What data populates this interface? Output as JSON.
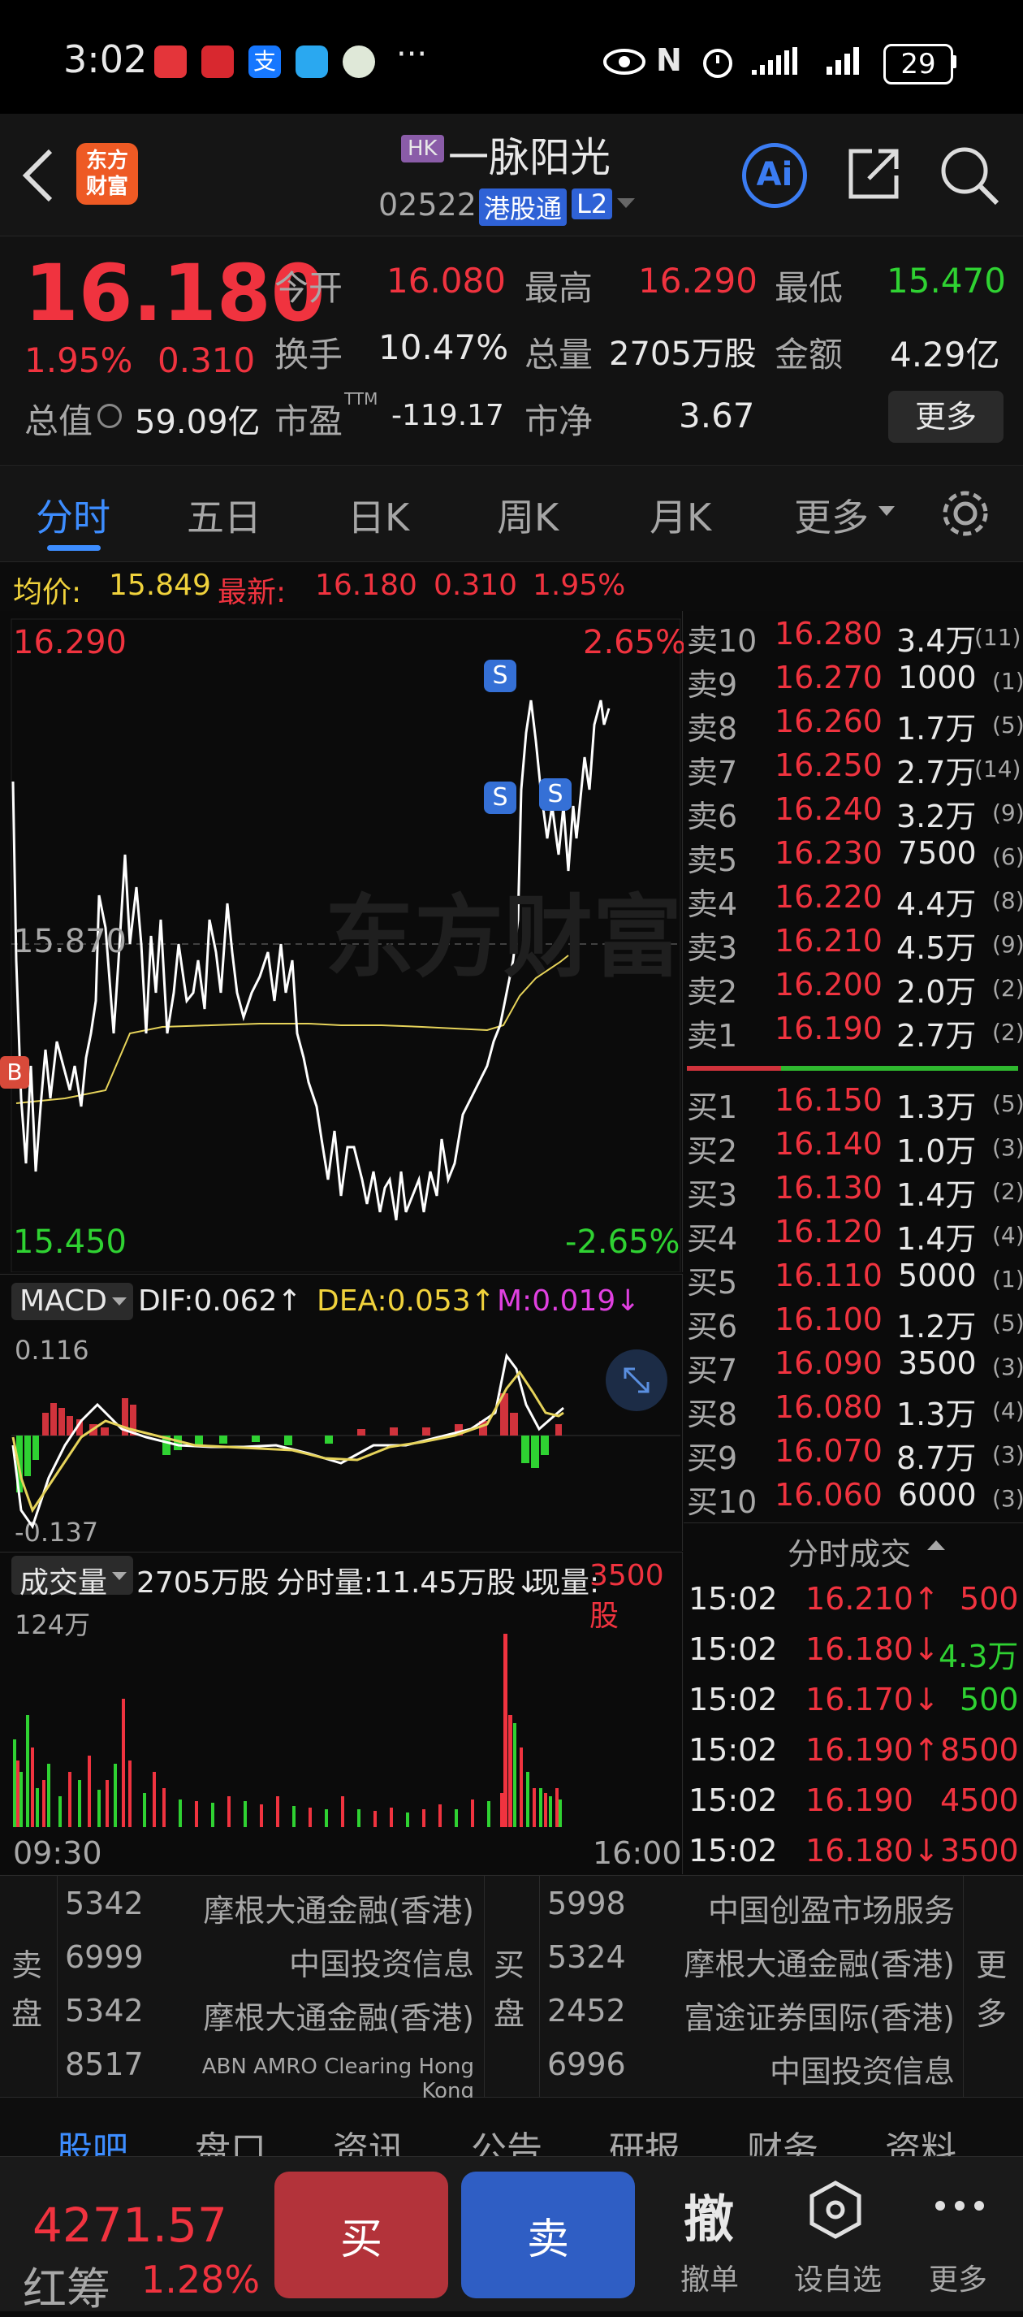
{
  "status_bar": {
    "time": "3:02",
    "more": "···",
    "battery": "29"
  },
  "header": {
    "back_icon": "chevron-left-icon",
    "app_logo_text": "东方\n财富",
    "market_tag": "HK",
    "stock_name": "一脉阳光",
    "stock_code": "02522",
    "connect_tag": "港股通",
    "level_tag": "L2",
    "ai_label": "Ai"
  },
  "quote": {
    "price": "16.180",
    "change_pct": "1.95%",
    "change": "0.310",
    "open_label": "今开",
    "open": "16.080",
    "high_label": "最高",
    "high": "16.290",
    "low_label": "最低",
    "low": "15.470",
    "turnover_label": "换手",
    "turnover": "10.47%",
    "volume_label": "总量",
    "volume": "2705万股",
    "amount_label": "金额",
    "amount": "4.29亿",
    "mktcap_label": "总值",
    "mktcap": "59.09亿",
    "pe_label": "市盈",
    "pe_sup": "TTM",
    "pe": "-119.17",
    "pb_label": "市净",
    "pb": "3.67",
    "more_button": "更多"
  },
  "tabs": [
    "分时",
    "五日",
    "日K",
    "周K",
    "月K",
    "更多"
  ],
  "avg_bar": {
    "avg_label": "均价:",
    "avg": "15.849",
    "latest_label": "最新:",
    "latest": "16.180",
    "latest_chg": "0.310",
    "latest_pct": "1.95%"
  },
  "intraday_chart": {
    "top_price": "16.290",
    "top_pct": "2.65%",
    "mid_price": "15.870",
    "bottom_price": "15.450",
    "bottom_pct": "-2.65%",
    "watermark": "东方财富",
    "marker_s": "S",
    "marker_b": "B",
    "colors": {
      "price": "#ffffff",
      "avg": "#e6d35a"
    }
  },
  "macd": {
    "selector": "MACD",
    "dif": "DIF:0.062↑",
    "dea": "DEA:0.053↑",
    "m": "M:0.019↓",
    "top_val": "0.116",
    "bottom_val": "-0.137"
  },
  "volume_panel": {
    "selector": "成交量",
    "total": "2705万股",
    "tick_label": "分时量:11.45万股↓",
    "now_label": "现量:",
    "now": "3500股",
    "max_label": "124万",
    "time_start": "09:30",
    "time_end": "16:00"
  },
  "order_book": {
    "asks": [
      {
        "label": "卖10",
        "price": "16.280",
        "qty": "3.4万",
        "count": "(11)"
      },
      {
        "label": "卖9",
        "price": "16.270",
        "qty": "1000",
        "count": "(1)"
      },
      {
        "label": "卖8",
        "price": "16.260",
        "qty": "1.7万",
        "count": "(5)"
      },
      {
        "label": "卖7",
        "price": "16.250",
        "qty": "2.7万",
        "count": "(14)"
      },
      {
        "label": "卖6",
        "price": "16.240",
        "qty": "3.2万",
        "count": "(9)"
      },
      {
        "label": "卖5",
        "price": "16.230",
        "qty": "7500",
        "count": "(6)"
      },
      {
        "label": "卖4",
        "price": "16.220",
        "qty": "4.4万",
        "count": "(8)"
      },
      {
        "label": "卖3",
        "price": "16.210",
        "qty": "4.5万",
        "count": "(9)"
      },
      {
        "label": "卖2",
        "price": "16.200",
        "qty": "2.0万",
        "count": "(2)"
      },
      {
        "label": "卖1",
        "price": "16.190",
        "qty": "2.7万",
        "count": "(2)"
      }
    ],
    "bids": [
      {
        "label": "买1",
        "price": "16.150",
        "qty": "1.3万",
        "count": "(5)"
      },
      {
        "label": "买2",
        "price": "16.140",
        "qty": "1.0万",
        "count": "(3)"
      },
      {
        "label": "买3",
        "price": "16.130",
        "qty": "1.4万",
        "count": "(2)"
      },
      {
        "label": "买4",
        "price": "16.120",
        "qty": "1.4万",
        "count": "(4)"
      },
      {
        "label": "买5",
        "price": "16.110",
        "qty": "5000",
        "count": "(1)"
      },
      {
        "label": "买6",
        "price": "16.100",
        "qty": "1.2万",
        "count": "(5)"
      },
      {
        "label": "买7",
        "price": "16.090",
        "qty": "3500",
        "count": "(3)"
      },
      {
        "label": "买8",
        "price": "16.080",
        "qty": "1.3万",
        "count": "(4)"
      },
      {
        "label": "买9",
        "price": "16.070",
        "qty": "8.7万",
        "count": "(3)"
      },
      {
        "label": "买10",
        "price": "16.060",
        "qty": "6000",
        "count": "(3)"
      }
    ]
  },
  "trades": {
    "title": "分时成交",
    "rows": [
      {
        "time": "15:02",
        "price": "16.210↑",
        "qty": "500",
        "dir": "up"
      },
      {
        "time": "15:02",
        "price": "16.180↓",
        "qty": "4.3万",
        "dir": "down"
      },
      {
        "time": "15:02",
        "price": "16.170↓",
        "qty": "500",
        "dir": "down"
      },
      {
        "time": "15:02",
        "price": "16.190↑",
        "qty": "8500",
        "dir": "up"
      },
      {
        "time": "15:02",
        "price": "16.190",
        "qty": "4500",
        "dir": "flat"
      },
      {
        "time": "15:02",
        "price": "16.180↓",
        "qty": "3500",
        "dir": "down"
      }
    ]
  },
  "brokers": {
    "sell_label": "卖\n盘",
    "buy_label": "买\n盘",
    "more_label": "更\n多",
    "sell": [
      {
        "code": "5342",
        "name": "摩根大通金融(香港)"
      },
      {
        "code": "6999",
        "name": "中国投资信息"
      },
      {
        "code": "5342",
        "name": "摩根大通金融(香港)"
      },
      {
        "code": "8517",
        "name": "ABN AMRO Clearing Hong Kong"
      }
    ],
    "buy": [
      {
        "code": "5998",
        "name": "中国创盈市场服务"
      },
      {
        "code": "5324",
        "name": "摩根大通金融(香港)"
      },
      {
        "code": "2452",
        "name": "富途证券国际(香港)"
      },
      {
        "code": "6996",
        "name": "中国投资信息"
      }
    ]
  },
  "bottom_tabs": [
    "股吧",
    "盘口",
    "资讯",
    "公告",
    "研报",
    "财务",
    "资料"
  ],
  "footer": {
    "index_value": "4271.57",
    "index_name": "红筹",
    "index_pct": "1.28%",
    "buy": "买",
    "sell": "卖",
    "cancel_icon_char": "撤",
    "cancel_label": "撤单",
    "watch_label": "设自选",
    "more_label": "更多"
  }
}
